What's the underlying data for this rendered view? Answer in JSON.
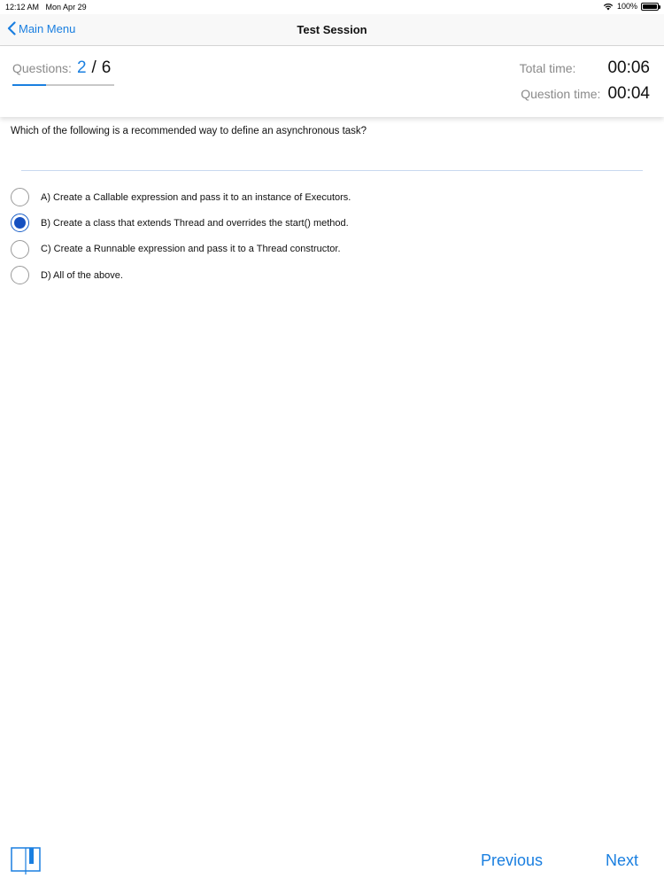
{
  "status_bar": {
    "time": "12:12 AM",
    "date": "Mon Apr 29",
    "battery": "100%"
  },
  "nav": {
    "back_label": "Main Menu",
    "title": "Test Session"
  },
  "progress": {
    "questions_label": "Questions:",
    "current": "2",
    "separator": "/",
    "total": "6",
    "fraction_complete": 0.333
  },
  "timers": {
    "total_label": "Total time:",
    "total_value": "00:06",
    "question_label": "Question time:",
    "question_value": "00:04"
  },
  "question": {
    "text": "Which of the following is a recommended way to define an asynchronous task?",
    "options": [
      {
        "label": "A) Create a Callable expression and pass it to an instance of Executors.",
        "selected": false
      },
      {
        "label": "B) Create a class that extends Thread and overrides the start() method.",
        "selected": true
      },
      {
        "label": "C) Create a Runnable expression and pass it to a Thread constructor.",
        "selected": false
      },
      {
        "label": "D) All of the above.",
        "selected": false
      }
    ]
  },
  "footer": {
    "bookmark_icon": "bookmark-icon",
    "previous_label": "Previous",
    "next_label": "Next"
  },
  "colors": {
    "accent": "#1a7fe0",
    "selected_radio": "#1550c0",
    "muted_text": "#8a8a8a"
  }
}
